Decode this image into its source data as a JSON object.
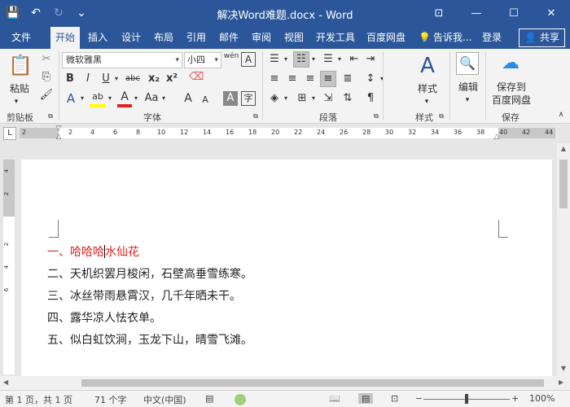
{
  "window": {
    "title": "解决Word难题.docx - Word",
    "controls": [
      "⊡",
      "—",
      "☐",
      "✕"
    ]
  },
  "qat": {
    "save_icon": "💾",
    "undo_icon": "↶",
    "redo_icon": "↻",
    "customize_icon": "⌄"
  },
  "tabs": [
    {
      "label": "文件",
      "active": false
    },
    {
      "label": "开始",
      "active": true
    },
    {
      "label": "插入",
      "active": false
    },
    {
      "label": "设计",
      "active": false
    },
    {
      "label": "布局",
      "active": false
    },
    {
      "label": "引用",
      "active": false
    },
    {
      "label": "邮件",
      "active": false
    },
    {
      "label": "审阅",
      "active": false
    },
    {
      "label": "视图",
      "active": false
    },
    {
      "label": "开发工具",
      "active": false
    },
    {
      "label": "百度网盘",
      "active": false
    }
  ],
  "tell_me": "告诉我...",
  "sign_in": "登录",
  "share": "共享",
  "ribbon": {
    "clipboard": {
      "label": "剪贴板",
      "paste": "粘贴"
    },
    "font": {
      "label": "字体",
      "font_name": "微软雅黑",
      "font_size": "小四",
      "wen_icon": "wén",
      "bold": "B",
      "italic": "I",
      "underline": "U",
      "strike": "abc",
      "subscript": "x₂",
      "superscript": "x²",
      "text_effects": "A",
      "highlight": "ab",
      "font_color": "A",
      "change_case": "Aa",
      "grow": "A",
      "shrink": "A"
    },
    "paragraph": {
      "label": "段落"
    },
    "styles": {
      "label": "样式",
      "button": "样式"
    },
    "editing": {
      "button": "编辑"
    },
    "save": {
      "label": "保存",
      "button_line1": "保存到",
      "button_line2": "百度网盘"
    }
  },
  "ruler_numbers": [
    "2",
    "2",
    "4",
    "6",
    "8",
    "10",
    "12",
    "14",
    "16",
    "18",
    "20",
    "22",
    "24",
    "26",
    "28",
    "30",
    "32",
    "34",
    "36",
    "38",
    "40",
    "42",
    "44"
  ],
  "vruler_numbers": [
    "4",
    "2",
    "2",
    "4",
    "6"
  ],
  "document": {
    "lines": [
      {
        "text_before": "一、哈哈哈",
        "text_after": "水仙花",
        "color": "#e02020"
      },
      {
        "text": "二、天机织罢月梭闲，石壁高垂雪练寒。"
      },
      {
        "text": "三、冰丝带雨悬霄汉，几千年晒未干。"
      },
      {
        "text": "四、露华凉人怯衣单。"
      },
      {
        "text": "五、似白虹饮涧，玉龙下山，晴雪飞滩。"
      }
    ]
  },
  "status": {
    "page": "第 1 页，共 1 页",
    "words": "71 个字",
    "language": "中文(中国)",
    "zoom": "100%",
    "zoom_minus": "−",
    "zoom_plus": "+"
  }
}
